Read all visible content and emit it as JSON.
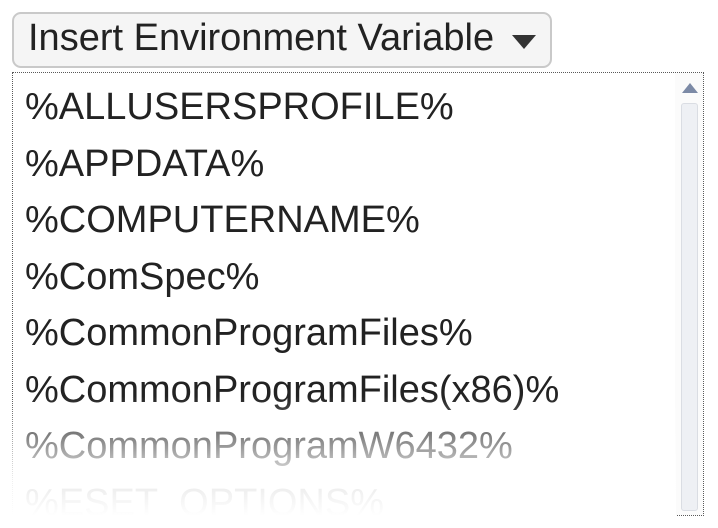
{
  "dropdown": {
    "label": "Insert Environment Variable"
  },
  "env_vars": [
    "%ALLUSERSPROFILE%",
    "%APPDATA%",
    "%COMPUTERNAME%",
    "%ComSpec%",
    "%CommonProgramFiles%",
    "%CommonProgramFiles(x86)%",
    "%CommonProgramW6432%",
    "%ESET_OPTIONS%"
  ]
}
